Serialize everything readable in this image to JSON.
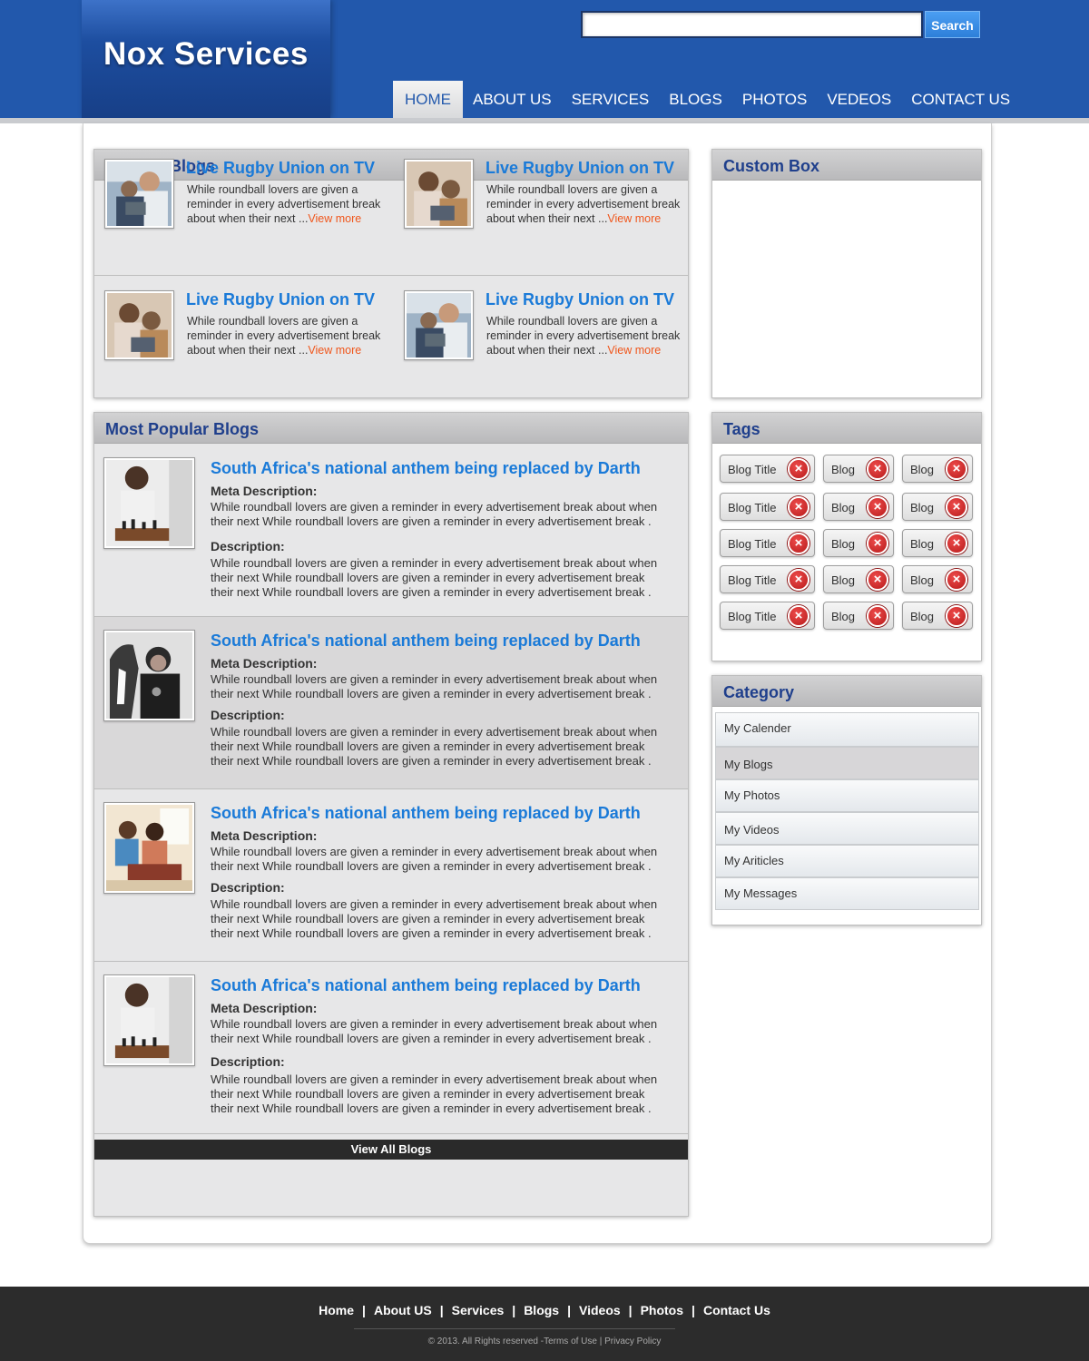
{
  "header": {
    "logo": "Nox Services",
    "search": {
      "placeholder": "",
      "button_label": "Search"
    },
    "nav": [
      "HOME",
      "ABOUT US",
      "SERVICES",
      "BLOGS",
      "PHOTOS",
      "VEDEOS",
      "CONTACT US"
    ],
    "active_nav": "HOME"
  },
  "featured": {
    "heading": "Fetured Blogs",
    "items": [
      {
        "title": "Live Rugby Union on TV",
        "text": "While roundball lovers are given a reminder in every advertisement break about when their next ...",
        "link": "View more",
        "image": "man-with-tablet-photo"
      },
      {
        "title": "Live Rugby Union on TV",
        "text": "While roundball lovers are given a reminder in every advertisement break about when their next ...",
        "link": "View more",
        "image": "mother-and-child-photo"
      },
      {
        "title": "Live Rugby Union on TV",
        "text": "While roundball lovers are given a reminder in every advertisement break about when their next ...",
        "link": "View more",
        "image": "mother-and-child-photo"
      },
      {
        "title": "Live Rugby Union on TV",
        "text": "While roundball lovers are given a reminder in every advertisement break about when their next ...",
        "link": "View more",
        "image": "man-with-tablet-photo"
      }
    ]
  },
  "popular": {
    "heading": "Most Popular Blogs",
    "meta_label": "Meta Description:",
    "desc_label": "Description:",
    "items": [
      {
        "title": "South Africa's national anthem being replaced by Darth",
        "meta": "While roundball lovers are given a reminder in every advertisement break about when their next While roundball lovers are given a reminder in every advertisement break .",
        "desc": "While roundball lovers are given a reminder in every advertisement break about when their next While roundball lovers are given a reminder in every advertisement break their next While roundball lovers are given a reminder in every advertisement break .",
        "image": "chess-players-photo"
      },
      {
        "title": "South Africa's national anthem being replaced by Darth",
        "meta": "While roundball lovers are given a reminder in every advertisement break about when their next While roundball lovers are given a reminder in every advertisement break .",
        "desc": "While roundball lovers are given a reminder in every advertisement break about when their next While roundball lovers are given a reminder in every advertisement break their next While roundball lovers are given a reminder in every advertisement break .",
        "image": "woman-with-horse-photo"
      },
      {
        "title": "South Africa's national anthem being replaced by Darth",
        "meta": "While roundball lovers are given a reminder in every advertisement break about when their next While roundball lovers are given a reminder in every advertisement break .",
        "desc": "While roundball lovers are given a reminder in every advertisement break about when their next While roundball lovers are given a reminder in every advertisement break their next While roundball lovers are given a reminder in every advertisement break .",
        "image": "family-playing-photo"
      },
      {
        "title": "South Africa's national anthem being replaced by Darth",
        "meta": "While roundball lovers are given a reminder in every advertisement break about when their next While roundball lovers are given a reminder in every advertisement break .",
        "desc": "While roundball lovers are given a reminder in every advertisement break about when their next While roundball lovers are given a reminder in every advertisement break their next While roundball lovers are given a reminder in every advertisement break .",
        "image": "chess-players-photo"
      }
    ],
    "view_all": "View All Blogs"
  },
  "custom_box": {
    "heading": "Custom Box"
  },
  "tags": {
    "heading": "Tags",
    "rows": [
      [
        "Blog Title",
        "Blog",
        "Blog"
      ],
      [
        "Blog Title",
        "Blog",
        "Blog"
      ],
      [
        "Blog Title",
        "Blog",
        "Blog"
      ],
      [
        "Blog Title",
        "Blog",
        "Blog"
      ],
      [
        "Blog Title",
        "Blog",
        "Blog"
      ]
    ],
    "remove_icon": "close-circle-icon"
  },
  "category": {
    "heading": "Category",
    "items": [
      "My Calender",
      "My Blogs",
      "My Photos",
      "My Videos",
      "My Ariticles",
      "My Messages"
    ],
    "active": "My Blogs"
  },
  "footer": {
    "links": [
      "Home",
      "About US",
      "Services",
      "Blogs",
      "Videos",
      "Photos",
      "Contact Us"
    ],
    "separator": "|",
    "copyright": "© 2013. All Rights reserved -Terms of Use | Privacy Policy"
  },
  "colors": {
    "header": "#2258ac",
    "link_blue": "#1a7ad8",
    "heading_blue": "#1f3f8c",
    "view_more": "#f0561b",
    "footer": "#2c2c2c"
  }
}
